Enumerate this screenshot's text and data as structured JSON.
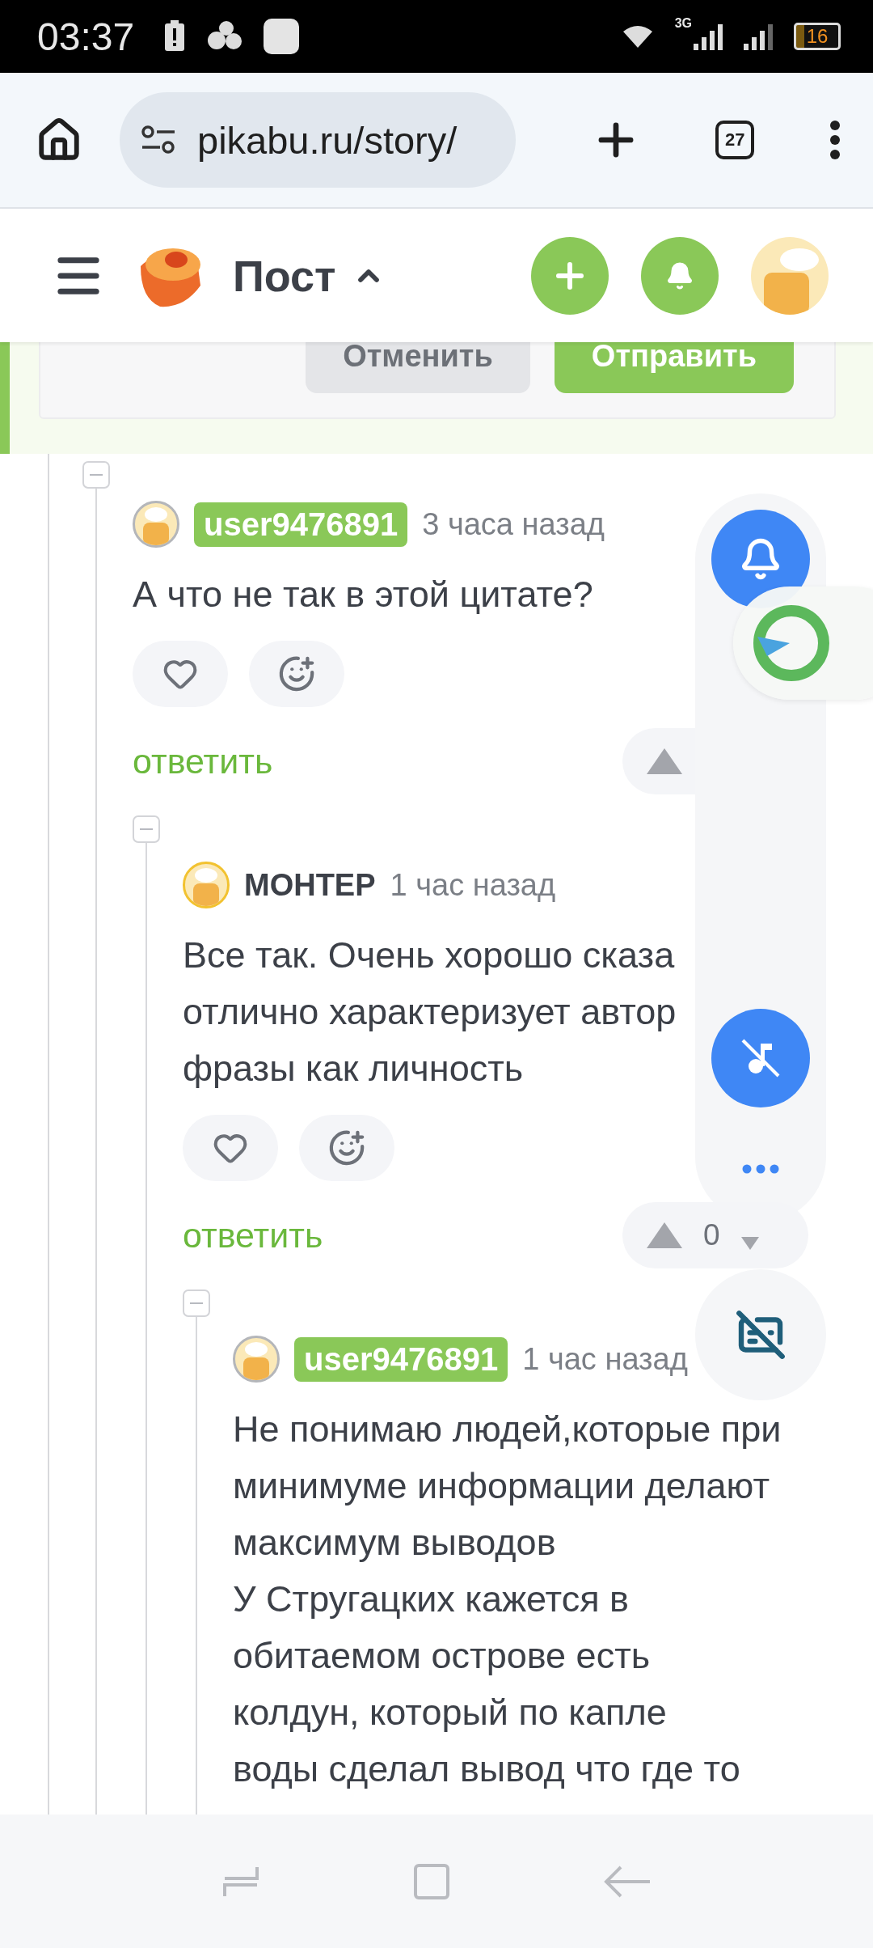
{
  "status_bar": {
    "time": "03:37",
    "network": "3G",
    "battery": "16"
  },
  "browser": {
    "url": "pikabu.ru/story/",
    "tab_count": "27"
  },
  "header": {
    "title": "Пост",
    "expanded": true
  },
  "reply_form": {
    "buttons": [
      {
        "label": "Отменить",
        "kind": "secondary"
      },
      {
        "label": "Отправить",
        "kind": "primary"
      }
    ]
  },
  "comments": [
    {
      "author": {
        "name": "user9476891",
        "kind": "badge",
        "color": "#b4b6ba"
      },
      "time": "3 часа назад",
      "lines": [
        "А что не так в этой цитате?"
      ],
      "reply_label": "ответить",
      "children": [
        {
          "author": {
            "name": "МОНТЕР",
            "kind": "plain",
            "color": "#f2c230"
          },
          "time": "1 час назад",
          "lines": [
            "Все так. Очень хорошо сказа",
            "отлично характеризует автор",
            "фразы как личность"
          ],
          "reply_label": "ответить",
          "vote_score": "0",
          "children": [
            {
              "author": {
                "name": "user9476891",
                "kind": "badge",
                "color": "#b4b6ba"
              },
              "time": "1 час назад",
              "lines": [
                "Не понимаю людей,которые при",
                "минимуме информации делают",
                "максимум выводов",
                "У Стругацких кажется в",
                "обитаемом острове есть",
                "колдун, который по капле",
                "воды сделал вывод что где то"
              ]
            }
          ]
        }
      ]
    }
  ]
}
